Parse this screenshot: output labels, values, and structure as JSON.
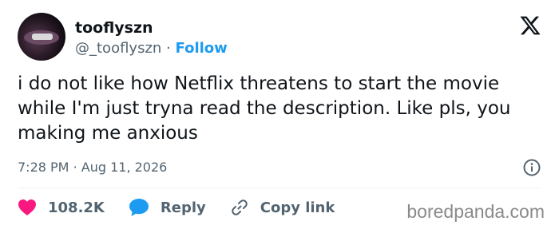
{
  "tweet": {
    "display_name": "tooflyszn",
    "handle": "@_tooflyszn",
    "separator": "·",
    "follow_label": "Follow",
    "text": "i do not like how Netflix threatens to start the movie while I'm just tryna read the description. Like pls, you making me anxious",
    "time": "7:28 PM",
    "date": "Aug 11, 2026",
    "meta_separator": "·"
  },
  "actions": {
    "likes": "108.2K",
    "reply_label": "Reply",
    "copy_label": "Copy link"
  },
  "watermark": "boredpanda.com",
  "colors": {
    "accent": "#1d9bf0",
    "like": "#f91880",
    "reply": "#1d9bf0",
    "text": "#0f1419",
    "muted": "#536471"
  },
  "icons": {
    "platform": "x-logo-icon",
    "info": "info-icon",
    "like": "heart-icon",
    "reply": "speech-bubble-icon",
    "copy": "link-icon"
  }
}
